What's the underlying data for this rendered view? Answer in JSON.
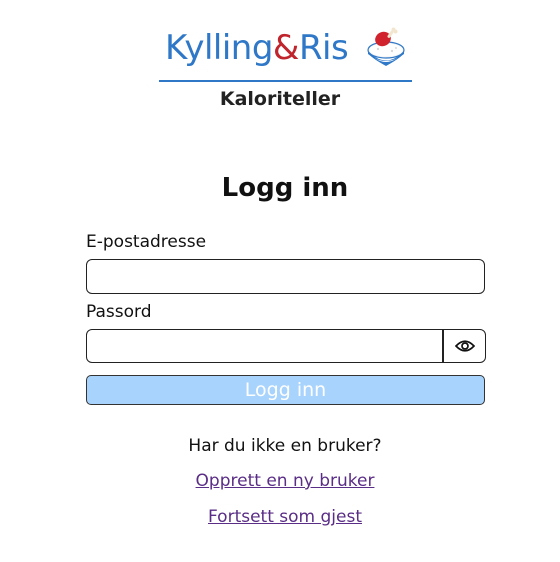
{
  "header": {
    "logo_word1": "Kylling",
    "logo_amp": "&",
    "logo_word2": "Ris",
    "logo_icon": "chicken-rice-bowl-icon",
    "subtitle": "Kaloriteller",
    "colors": {
      "brand_blue": "#2e78c7",
      "brand_red": "#c0242c"
    }
  },
  "form": {
    "title": "Logg inn",
    "email_label": "E-postadresse",
    "email_value": "",
    "password_label": "Passord",
    "password_value": "",
    "toggle_icon": "eye-icon",
    "submit_label": "Logg inn",
    "submit_color": "#a8d3fd"
  },
  "footer": {
    "prompt": "Har du ikke en bruker?",
    "create_account_link": "Opprett en ny bruker",
    "guest_link": "Fortsett som gjest",
    "link_color": "#5a2d86"
  }
}
